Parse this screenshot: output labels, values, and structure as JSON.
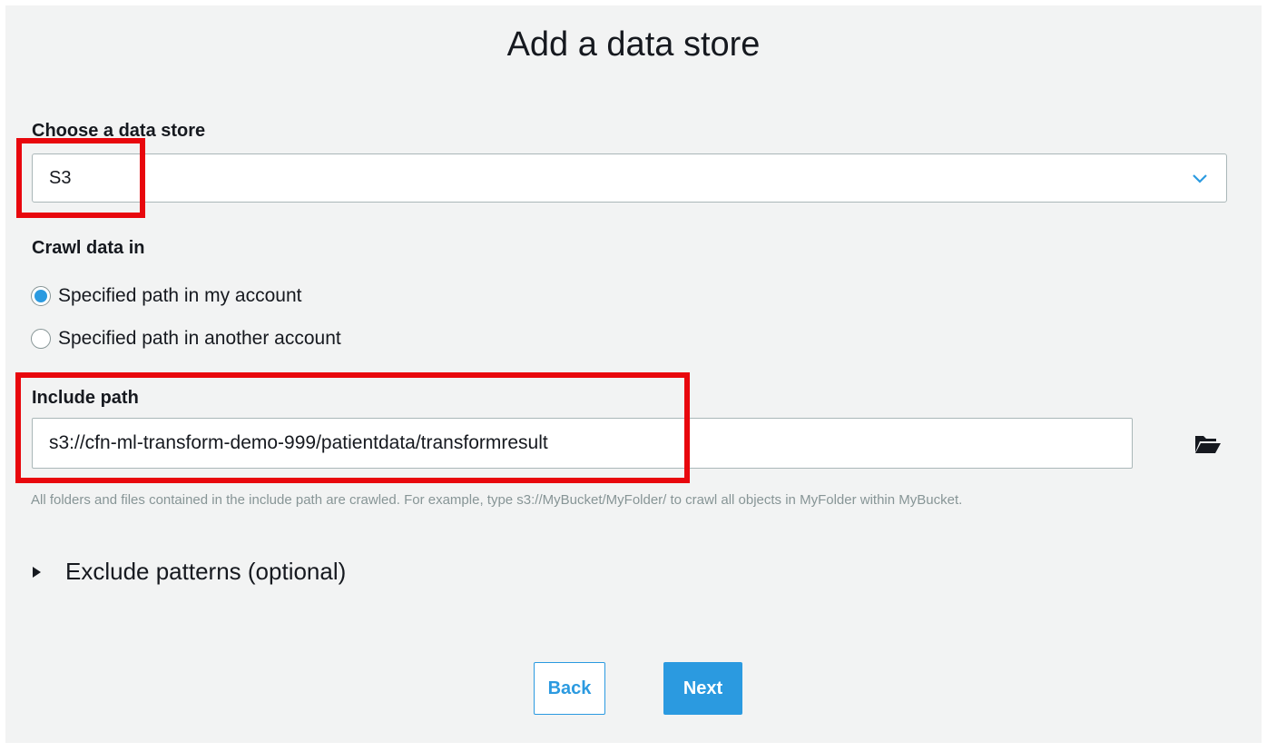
{
  "dialog": {
    "title": "Add a data store"
  },
  "data_store": {
    "label": "Choose a data store",
    "selected": "S3",
    "dropdown_icon": "chevron-down-icon"
  },
  "crawl": {
    "label": "Crawl data in",
    "options": [
      {
        "label": "Specified path in my account",
        "checked": true
      },
      {
        "label": "Specified path in another account",
        "checked": false
      }
    ]
  },
  "include_path": {
    "label": "Include path",
    "value": "s3://cfn-ml-transform-demo-999/patientdata/transformresult",
    "browse_icon": "folder-open-icon",
    "help_text": "All folders and files contained in the include path are crawled. For example, type s3://MyBucket/MyFolder/ to crawl all objects in MyFolder within MyBucket."
  },
  "exclude": {
    "label": "Exclude patterns (optional)",
    "expand_icon": "caret-right-icon"
  },
  "buttons": {
    "back": "Back",
    "next": "Next"
  },
  "colors": {
    "accent": "#2b9ae0",
    "highlight": "#e8070d",
    "panel_bg": "#f2f3f3",
    "help_text": "#879596"
  }
}
